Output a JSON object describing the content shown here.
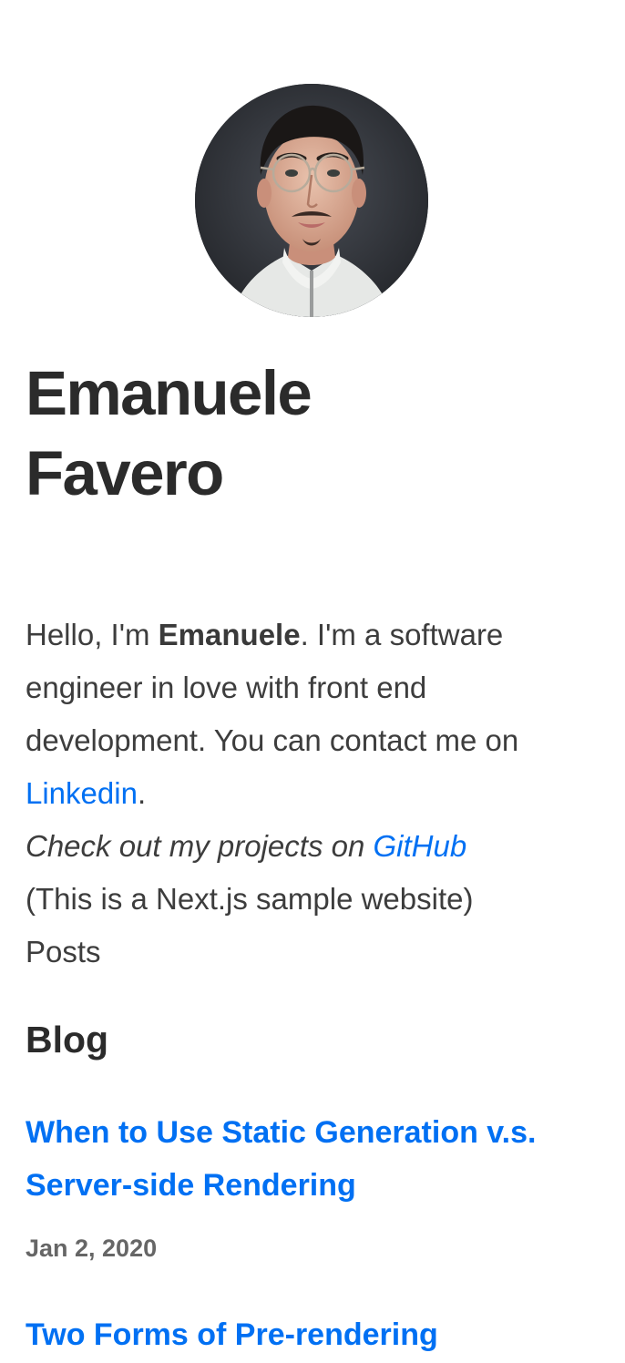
{
  "profile": {
    "name_line1": "Emanuele",
    "name_line2": "Favero"
  },
  "intro": {
    "greeting_prefix": "Hello, I'm ",
    "greeting_name": "Emanuele",
    "greeting_suffix": ". I'm a software",
    "line2": "engineer in love with front end",
    "line3": "development. You can contact me on",
    "linkedin_label": "Linkedin",
    "linkedin_suffix": ".",
    "projects_text": "Check out my projects on ",
    "github_label": "GitHub",
    "sample_note": "(This is a Next.js sample website)",
    "posts_label": "Posts"
  },
  "blog": {
    "title": "Blog",
    "posts": [
      {
        "title_line1": "When to Use Static Generation v.s.",
        "title_line2": "Server-side Rendering",
        "date": "Jan 2, 2020"
      },
      {
        "title_line1": "Two Forms of Pre-rendering"
      }
    ]
  },
  "colors": {
    "link": "#0070f3",
    "text": "#333333",
    "muted": "#666666",
    "background": "#ffffff"
  }
}
